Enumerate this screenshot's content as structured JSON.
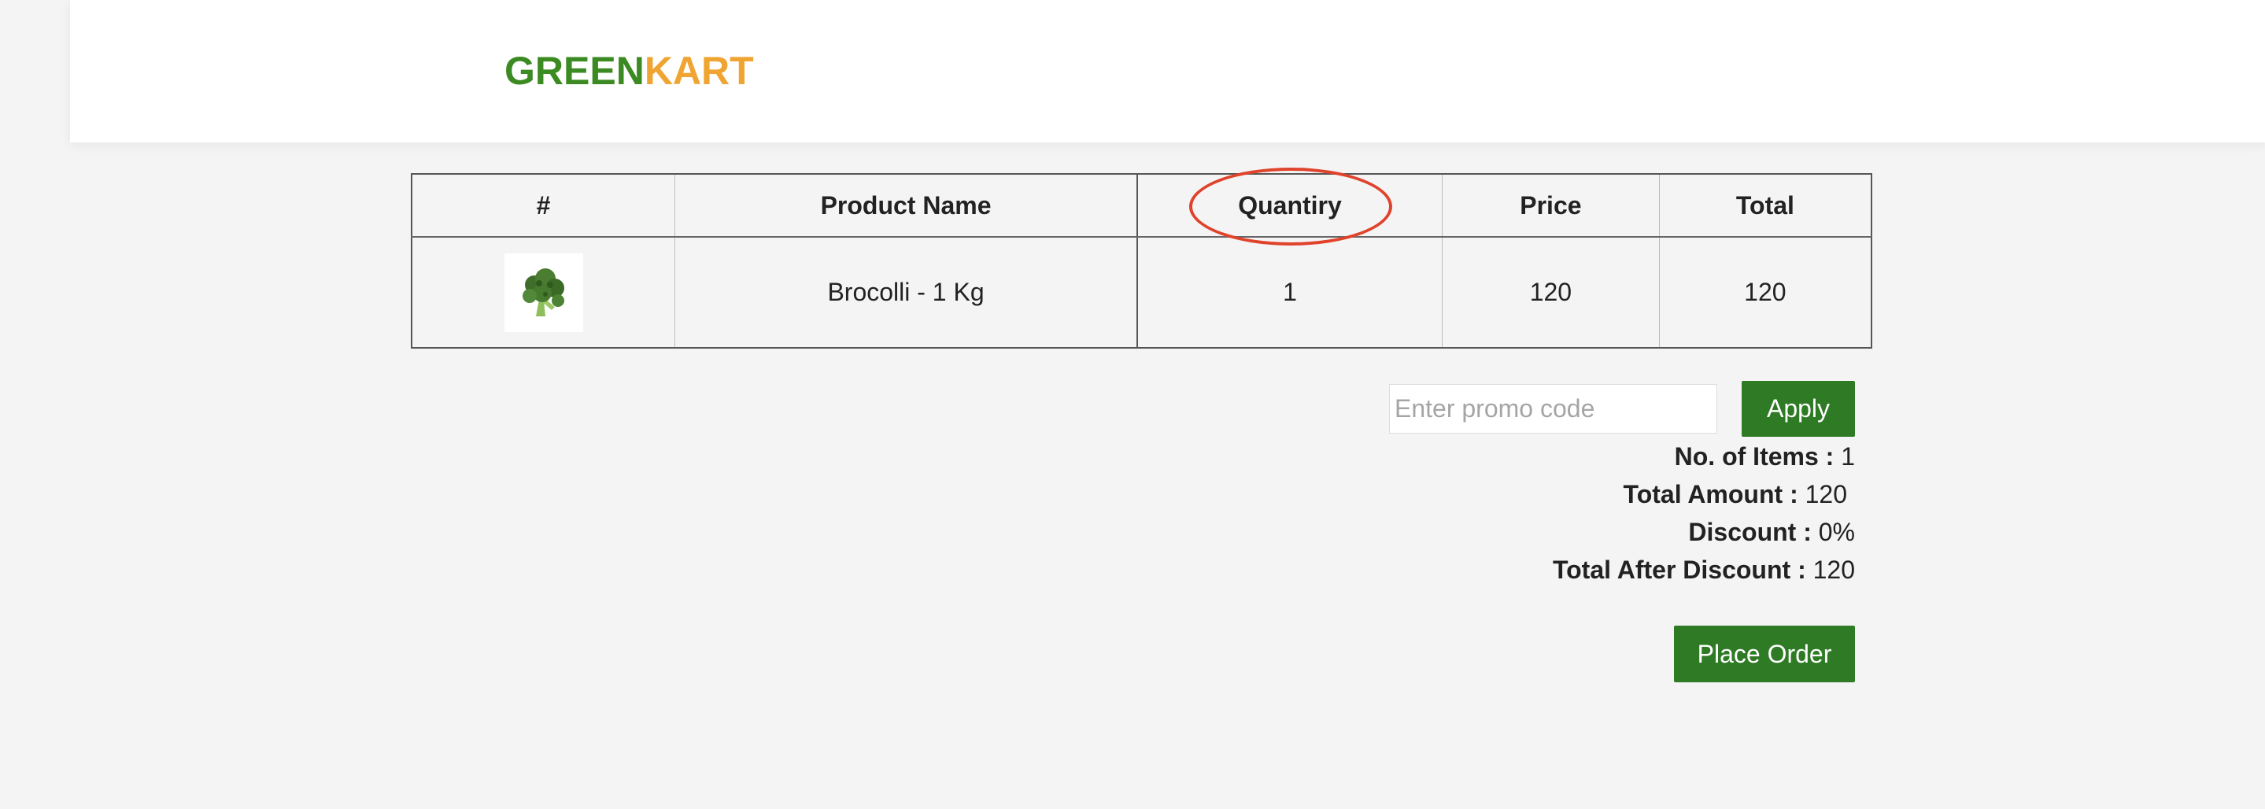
{
  "brand": {
    "part1": "GREEN",
    "part2": "KART"
  },
  "table": {
    "headers": [
      "#",
      "Product Name",
      "Quantiry",
      "Price",
      "Total"
    ],
    "rows": [
      {
        "image": "broccoli-image",
        "name": "Brocolli - 1 Kg",
        "quantity": "1",
        "price": "120",
        "total": "120"
      }
    ]
  },
  "promo": {
    "placeholder": "Enter promo code",
    "value": "",
    "apply_label": "Apply"
  },
  "summary": {
    "items_label": "No. of Items :",
    "items_value": "1",
    "amount_label": "Total Amount :",
    "amount_value": "120",
    "discount_label": "Discount :",
    "discount_value": "0%",
    "after_label": "Total After Discount :",
    "after_value": "120"
  },
  "place_order_label": "Place Order",
  "colors": {
    "brand_green": "#3b8a22",
    "brand_orange": "#f0a431",
    "button_green": "#2f7a25",
    "annotation_red": "#e0432b"
  }
}
